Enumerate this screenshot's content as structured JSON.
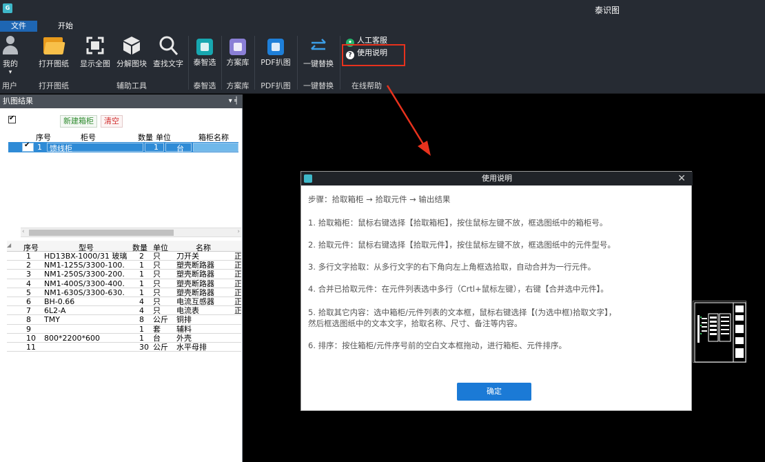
{
  "app": {
    "title": "泰识图"
  },
  "menu": {
    "tabs": [
      "文件",
      "开始"
    ]
  },
  "ribbon": {
    "buttons": [
      {
        "label": "我的",
        "icon": "user-icon"
      },
      {
        "label": "打开图纸",
        "icon": "folder-icon"
      },
      {
        "label": "显示全图",
        "icon": "fullscreen-icon"
      },
      {
        "label": "分解图块",
        "icon": "cube-icon"
      },
      {
        "label": "查找文字",
        "icon": "search-icon"
      },
      {
        "label": "泰智选",
        "icon": "robot-icon"
      },
      {
        "label": "方案库",
        "icon": "library-icon"
      },
      {
        "label": "PDF扒图",
        "icon": "pdf-icon"
      },
      {
        "label": "一键替换",
        "icon": "swap-icon"
      }
    ],
    "groups": [
      "用户",
      "打开图纸",
      "辅助工具",
      "泰智选",
      "方案库",
      "PDF扒图",
      "一键替换",
      "在线帮助"
    ],
    "help": {
      "service": "人工客服",
      "manual": "使用说明"
    },
    "dropdown_arrow": "▾"
  },
  "panel": {
    "title": "扒图结果",
    "pin_icon": "▾ ╡",
    "new_cabinet": "新建箱柜",
    "clear": "清空",
    "cabinet_grid": {
      "headers": [
        "序号",
        "柜号",
        "数量",
        "单位",
        "箱柜名称"
      ],
      "rows": [
        {
          "seq": "1",
          "name": "馈线柜",
          "qty": "1",
          "unit": "台",
          "cname": ""
        }
      ]
    },
    "component_grid": {
      "headers": [
        "序号",
        "型号",
        "数量",
        "单位",
        "名称"
      ],
      "rows": [
        {
          "seq": "1",
          "model": "HD13BX-1000/31 玻璃",
          "qty": "2",
          "unit": "只",
          "name": "刀开关",
          "extra": "正"
        },
        {
          "seq": "2",
          "model": "NM1-125S/3300-100.",
          "qty": "1",
          "unit": "只",
          "name": "塑壳断路器",
          "extra": "正"
        },
        {
          "seq": "3",
          "model": "NM1-250S/3300-200.",
          "qty": "1",
          "unit": "只",
          "name": "塑壳断路器",
          "extra": "正"
        },
        {
          "seq": "4",
          "model": "NM1-400S/3300-400.",
          "qty": "1",
          "unit": "只",
          "name": "塑壳断路器",
          "extra": "正"
        },
        {
          "seq": "5",
          "model": "NM1-630S/3300-630.",
          "qty": "1",
          "unit": "只",
          "name": "塑壳断路器",
          "extra": "正"
        },
        {
          "seq": "6",
          "model": "BH-0.66",
          "qty": "4",
          "unit": "只",
          "name": "电流互感器",
          "extra": "正"
        },
        {
          "seq": "7",
          "model": "6L2-A",
          "qty": "4",
          "unit": "只",
          "name": "电流表",
          "extra": "正"
        },
        {
          "seq": "8",
          "model": "TMY",
          "qty": "8",
          "unit": "公斤",
          "name": "铜排",
          "extra": ""
        },
        {
          "seq": "9",
          "model": "",
          "qty": "1",
          "unit": "套",
          "name": "辅料",
          "extra": ""
        },
        {
          "seq": "10",
          "model": "800*2200*600",
          "qty": "1",
          "unit": "台",
          "name": "外壳",
          "extra": ""
        },
        {
          "seq": "11",
          "model": "",
          "qty": "30",
          "unit": "公斤",
          "name": "水平母排",
          "extra": ""
        }
      ]
    }
  },
  "dialog": {
    "title": "使用说明",
    "close": "✕",
    "lines": [
      "步骤：拾取箱柜 → 拾取元件 → 输出结果",
      "1. 拾取箱柜：鼠标右键选择【拾取箱柜】，按住鼠标左键不放，框选图纸中的箱柜号。",
      "2. 拾取元件：鼠标右键选择【拾取元件】，按住鼠标左键不放，框选图纸中的元件型号。",
      "3. 多行文字拾取：从多行文字的右下角向左上角框选拾取，自动合并为一行元件。",
      "4. 合并已拾取元件：在元件列表选中多行（Crtl+鼠标左键），右键【合并选中元件】。",
      "5. 拾取其它内容：选中箱柜/元件列表的文本框，鼠标右键选择【(为选中框)拾取文字】，",
      "然后框选图纸中的文本文字，拾取名称、尺寸、备注等内容。",
      "6. 排序：按住箱柜/元件序号前的空白文本框拖动，进行箱柜、元件排序。"
    ],
    "ok": "确定"
  },
  "colors": {
    "ribbon_bg": "#262b33",
    "accent": "#1b7ad6",
    "highlight": "#e8321d",
    "selected_row": "#2f8bd6"
  }
}
